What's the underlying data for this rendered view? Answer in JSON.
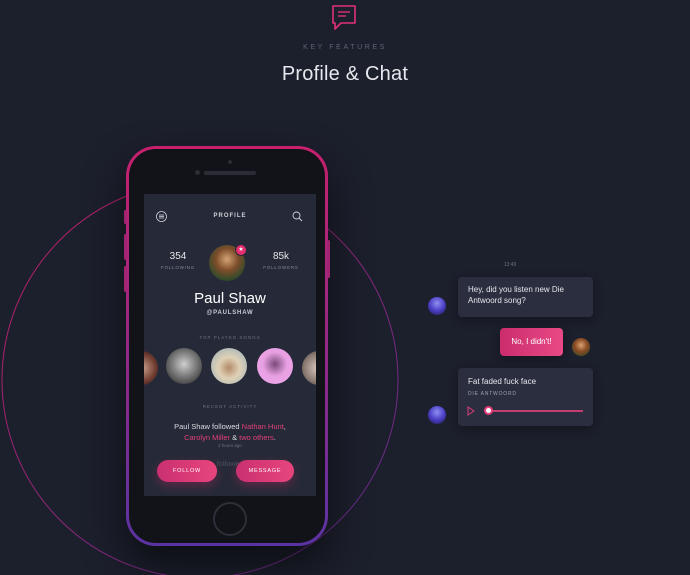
{
  "header": {
    "kicker": "KEY FEATURES",
    "title": "Profile & Chat"
  },
  "colors": {
    "background": "#1c1f2c",
    "accent": "#e23e7a",
    "card": "#2a2e3e",
    "screen": "#262a38"
  },
  "profile_screen": {
    "title": "PROFILE",
    "following_count": "354",
    "following_label": "FOLLOWING",
    "followers_count": "85k",
    "followers_label": "FOLLOWERS",
    "name": "Paul Shaw",
    "handle": "@PAULSHAW",
    "top_songs_label": "TOP PLAYED SONGS",
    "recent_label": "RECENT ACTIVITY",
    "activity": {
      "prefix": "Paul Shaw followed ",
      "person1": "Nathan Hunt",
      "sep": ",",
      "person2": "Carolyn Miller",
      "amp": " & ",
      "others": "two others",
      "end": "."
    },
    "time_ago": "2 hours ago",
    "ghost_text": "followed &",
    "follow_button": "FOLLOW",
    "message_button": "MESSAGE",
    "icons": [
      "menu-icon",
      "search-icon",
      "star-badge-icon"
    ]
  },
  "chat": {
    "time": "13:49",
    "messages": [
      {
        "text": "Hey, did you listen new Die Antwoord song?",
        "from": "them"
      },
      {
        "text": "No, I didn't!",
        "from": "me"
      }
    ],
    "track": {
      "title": "Fat faded fuck face",
      "artist": "DIE ANTWOORD",
      "progress": 0.05
    }
  }
}
